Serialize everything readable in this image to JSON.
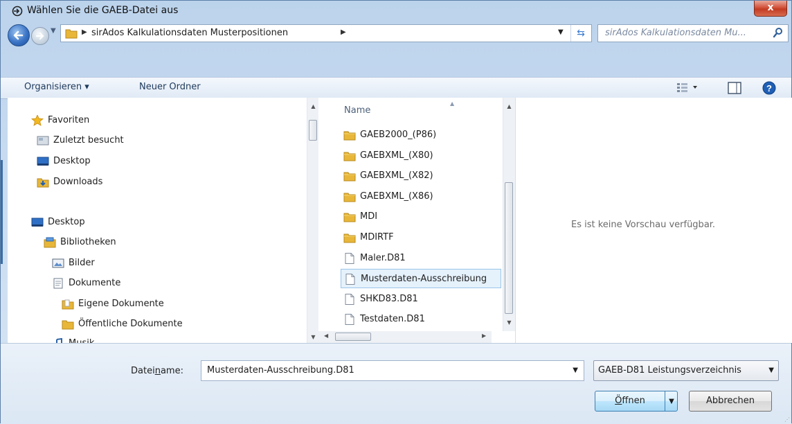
{
  "window": {
    "title": "Wählen Sie die GAEB-Datei aus",
    "close_label": "x"
  },
  "address": {
    "crumbs": [
      "sirAdos Kalkulationsdaten Musterpositionen"
    ],
    "search_placeholder": "sirAdos Kalkulationsdaten Mu..."
  },
  "toolbar": {
    "organize_label": "Organisieren ▾",
    "new_folder_label": "Neuer Ordner"
  },
  "nav": {
    "favorites": "Favoriten",
    "recent": "Zuletzt besucht",
    "desktop_fav": "Desktop",
    "downloads": "Downloads",
    "desktop": "Desktop",
    "libraries": "Bibliotheken",
    "pictures": "Bilder",
    "documents": "Dokumente",
    "my_documents": "Eigene Dokumente",
    "public_documents": "Öffentliche Dokumente",
    "music": "Musik"
  },
  "files": {
    "column_name": "Name",
    "items": [
      {
        "name": "GAEB2000_(P86)",
        "type": "folder"
      },
      {
        "name": "GAEBXML_(X80)",
        "type": "folder"
      },
      {
        "name": "GAEBXML_(X82)",
        "type": "folder"
      },
      {
        "name": "GAEBXML_(X86)",
        "type": "folder"
      },
      {
        "name": "MDI",
        "type": "folder"
      },
      {
        "name": "MDIRTF",
        "type": "folder"
      },
      {
        "name": "Maler.D81",
        "type": "file"
      },
      {
        "name": "Musterdaten-Ausschreibung",
        "type": "file",
        "selected": true
      },
      {
        "name": "SHKD83.D81",
        "type": "file"
      },
      {
        "name": "Testdaten.D81",
        "type": "file"
      }
    ]
  },
  "preview": {
    "message": "Es ist keine Vorschau verfügbar."
  },
  "footer": {
    "filename_label_pre": "Datei",
    "filename_label_ul": "n",
    "filename_label_post": "ame:",
    "filename_value": "Musterdaten-Ausschreibung.D81",
    "filetype_value": "GAEB-D81 Leistungsverzeichnis",
    "open_pre": "",
    "open_ul": "Ö",
    "open_post": "ffnen",
    "cancel_label": "Abbrechen"
  },
  "colors": {
    "accent": "#3c7fb1",
    "folder": "#e8b73a",
    "selection": "#e5f1fb"
  }
}
